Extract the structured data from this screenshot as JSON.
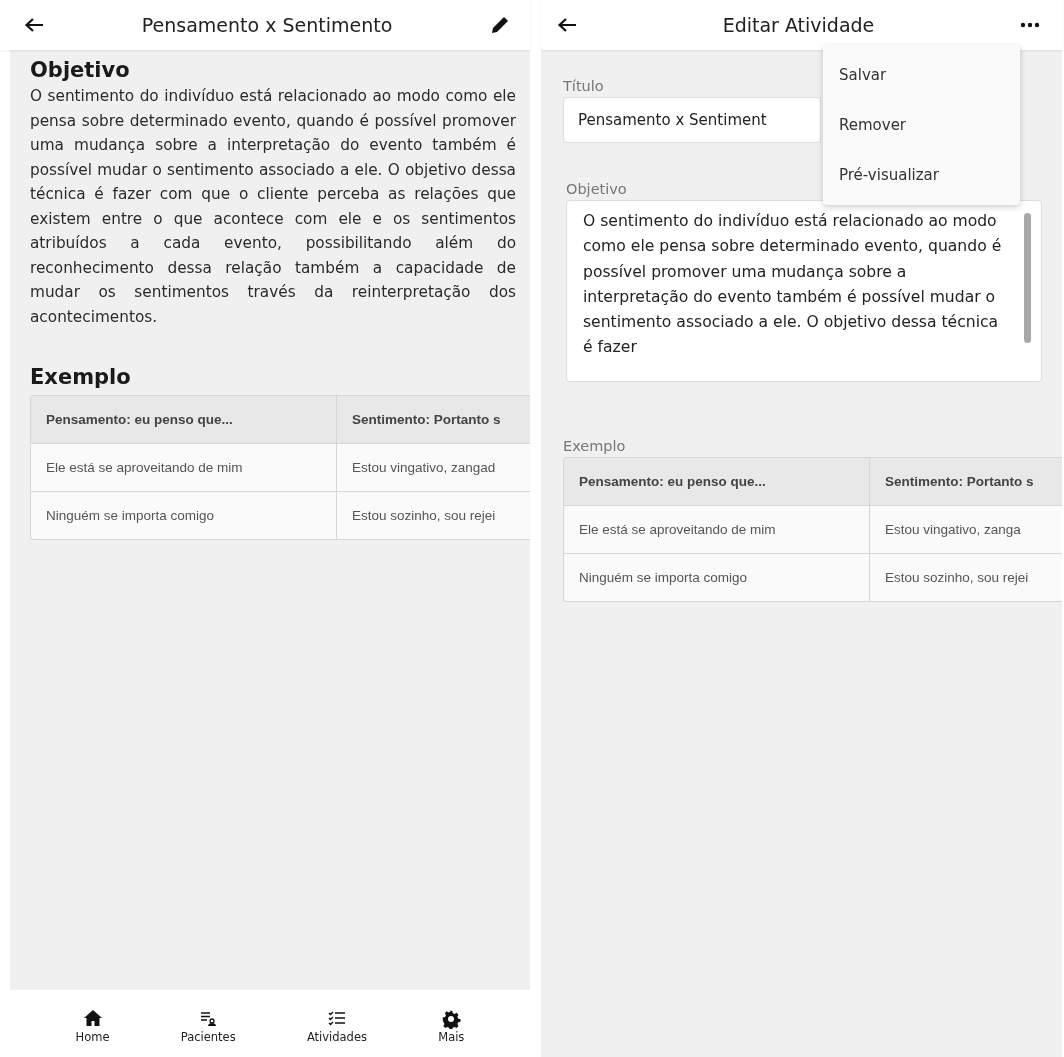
{
  "left_screen": {
    "title": "Pensamento x Sentimento",
    "objective_heading": "Objetivo",
    "objective_text": "O sentimento do indivíduo está relacionado ao modo como ele pensa sobre determinado evento, quando é possível promover uma mudança sobre a interpretação do evento também é possível mudar o sentimento associado a ele. O objetivo dessa técnica é fazer com que o cliente perceba as relações que existem entre o que acontece com ele e os sentimentos atribuídos a cada evento, possibilitando além do reconhecimento dessa relação também a capacidade de mudar os sentimentos través da reinterpretação dos acontecimentos.",
    "example_heading": "Exemplo",
    "table": {
      "columns": [
        "Pensamento: eu penso que...",
        "Sentimento: Portanto s"
      ],
      "rows": [
        [
          "Ele está se aproveitando de mim",
          "Estou vingativo, zangad"
        ],
        [
          "Ninguém se importa comigo",
          "Estou sozinho, sou rejei"
        ]
      ]
    },
    "bottom_nav": [
      {
        "label": "Home"
      },
      {
        "label": "Pacientes"
      },
      {
        "label": "Atividades"
      },
      {
        "label": "Mais"
      }
    ]
  },
  "right_screen": {
    "title": "Editar Atividade",
    "title_field": {
      "label": "Título",
      "value": "Pensamento x Sentiment"
    },
    "objective_field": {
      "label": "Objetivo",
      "value": "O sentimento do indivíduo está relacionado ao modo como ele pensa sobre determinado evento, quando é possível promover uma mudança sobre a interpretação do evento também é possível mudar o sentimento associado a ele. O objetivo dessa técnica é fazer"
    },
    "example_label": "Exemplo",
    "table": {
      "columns": [
        "Pensamento: eu penso que...",
        "Sentimento: Portanto s"
      ],
      "rows": [
        [
          "Ele está se aproveitando de mim",
          "Estou vingativo, zanga"
        ],
        [
          "Ninguém se importa comigo",
          "Estou sozinho, sou rejei"
        ]
      ]
    },
    "menu": [
      "Salvar",
      "Remover",
      "Pré-visualizar"
    ]
  }
}
